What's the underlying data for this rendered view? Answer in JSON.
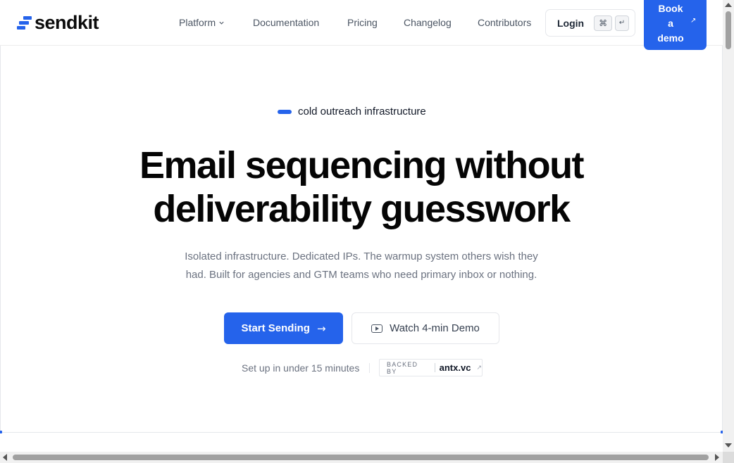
{
  "brand": {
    "name": "sendkit",
    "accent": "#2563eb"
  },
  "nav": {
    "items": [
      {
        "label": "Platform",
        "has_dropdown": true
      },
      {
        "label": "Documentation"
      },
      {
        "label": "Pricing"
      },
      {
        "label": "Changelog"
      },
      {
        "label": "Contributors"
      }
    ],
    "login_label": "Login",
    "login_kbd": [
      "⌘",
      "↵"
    ],
    "demo_lines": [
      "Book",
      "a",
      "demo"
    ],
    "demo_icon": "arrow-up-right-icon"
  },
  "hero": {
    "eyebrow": "cold outreach infrastructure",
    "headline_lines": [
      "Email sequencing without",
      "deliverability guesswork"
    ],
    "subhead_lines": [
      "Isolated infrastructure. Dedicated IPs. The warmup system others wish they",
      "had. Built for agencies and GTM teams who need primary inbox or nothing."
    ],
    "cta_primary": "Start Sending",
    "cta_primary_icon": "arrow-right-icon",
    "cta_secondary": "Watch 4-min Demo",
    "cta_secondary_icon": "play-icon",
    "setup_note": "Set up in under 15 minutes",
    "backed_label": "BACKED BY",
    "backed_name": "antx.vc",
    "backed_icon": "arrow-up-right-icon"
  }
}
